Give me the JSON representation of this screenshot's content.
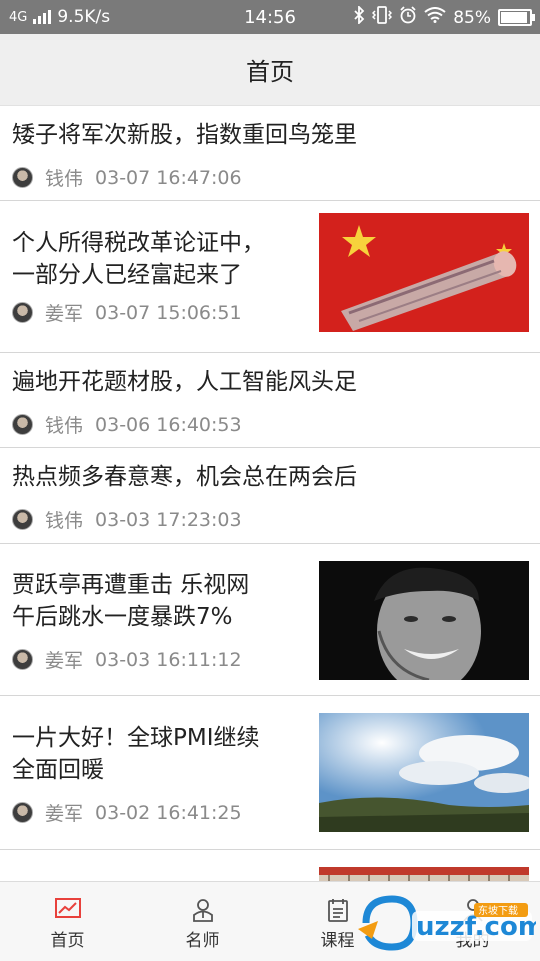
{
  "status": {
    "network": "4G",
    "speed": "9.5K/s",
    "time": "14:56",
    "battery": "85%"
  },
  "header": {
    "title": "首页"
  },
  "articles": [
    {
      "title1": "矮子将军次新股，指数重回鸟笼里",
      "title2": "",
      "author": "钱伟",
      "datetime": "03-07 16:47:06",
      "image": ""
    },
    {
      "title1": "个人所得税改革论证中，",
      "title2": "一部分人已经富起来了",
      "author": "姜军",
      "datetime": "03-07 15:06:51",
      "image": "money-roll-flag"
    },
    {
      "title1": "遍地开花题材股，人工智能风头足",
      "title2": "",
      "author": "钱伟",
      "datetime": "03-06 16:40:53",
      "image": ""
    },
    {
      "title1": "热点频多春意寒，机会总在两会后",
      "title2": "",
      "author": "钱伟",
      "datetime": "03-03 17:23:03",
      "image": ""
    },
    {
      "title1": "贾跃亭再遭重击 乐视网",
      "title2": "午后跳水一度暴跌7%",
      "author": "姜军",
      "datetime": "03-03 16:11:12",
      "image": "man-portrait"
    },
    {
      "title1": "一片大好！全球PMI继续",
      "title2": "全面回暖",
      "author": "姜军",
      "datetime": "03-02 16:41:25",
      "image": "sky-landscape"
    },
    {
      "title1": "",
      "title2": "",
      "author": "",
      "datetime": "",
      "image": "building-flag"
    }
  ],
  "nav": [
    {
      "label": "首页",
      "icon": "chart-icon"
    },
    {
      "label": "名师",
      "icon": "teacher-icon"
    },
    {
      "label": "课程",
      "icon": "calendar-icon"
    },
    {
      "label": "我的",
      "icon": "person-icon"
    }
  ],
  "watermark": {
    "text": "uzzf.com",
    "tag": "东坡下载"
  },
  "colors": {
    "accent": "#e8413c",
    "header_bg": "#efefef",
    "status_bg": "#7a7a7a"
  }
}
